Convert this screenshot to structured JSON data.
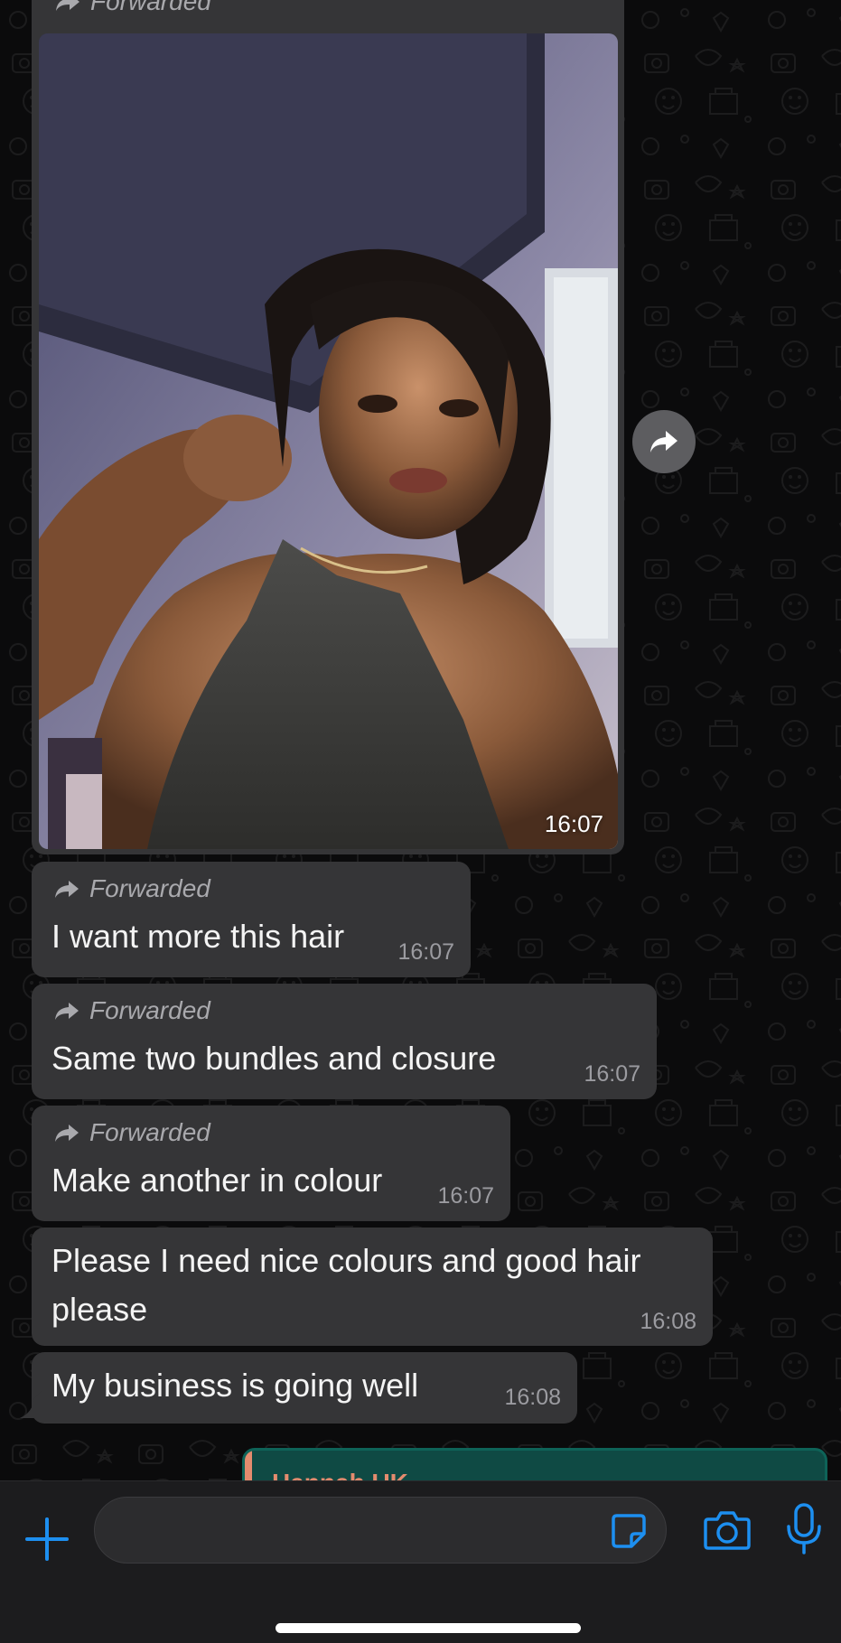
{
  "chat": {
    "top_partial_label": "Forwarded",
    "image_message": {
      "time": "16:07",
      "alt": "Forwarded selfie photo"
    },
    "messages": [
      {
        "forwarded_label": "Forwarded",
        "lines": [
          "I want more this hair"
        ],
        "time": "16:07"
      },
      {
        "forwarded_label": "Forwarded",
        "lines": [
          "Same two bundles and closure"
        ],
        "time": "16:07"
      },
      {
        "forwarded_label": "Forwarded",
        "lines": [
          "Make another in colour"
        ],
        "time": "16:07"
      },
      {
        "forwarded_label": "",
        "lines": [
          "Please I need nice colours and good hair",
          "please"
        ],
        "time": "16:08"
      },
      {
        "forwarded_label": "",
        "lines": [
          "My business is going well"
        ],
        "time": "16:08"
      }
    ],
    "reply_preview_name": "Hannah UK"
  },
  "composer": {
    "placeholder": "",
    "icons": {
      "attach": "plus-icon",
      "sticker": "sticker-icon",
      "camera": "camera-icon",
      "mic": "microphone-icon",
      "share": "share-forward-icon"
    }
  },
  "colors": {
    "bubble": "#353537",
    "accent": "#1d8ff0",
    "background": "#0b0b0c"
  }
}
